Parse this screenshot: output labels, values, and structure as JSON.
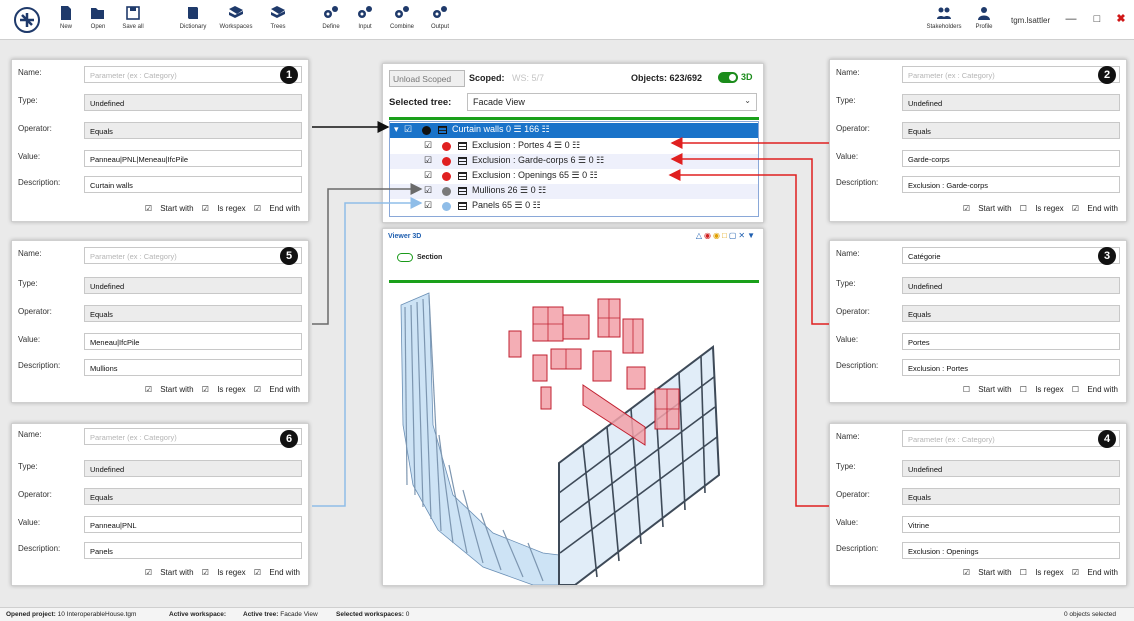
{
  "toolbar": {
    "buttons": [
      {
        "label": "New",
        "icon": "file-icon"
      },
      {
        "label": "Open",
        "icon": "folder-open-icon"
      },
      {
        "label": "Save all",
        "icon": "save-icon"
      },
      {
        "label": "Dictionary",
        "icon": "book-icon"
      },
      {
        "label": "Workspaces",
        "icon": "tag-icon"
      },
      {
        "label": "Trees",
        "icon": "tag-icon"
      },
      {
        "label": "Define",
        "icon": "gears-icon"
      },
      {
        "label": "Input",
        "icon": "gears-icon"
      },
      {
        "label": "Combine",
        "icon": "gears-icon"
      },
      {
        "label": "Output",
        "icon": "gears-icon"
      }
    ],
    "right_buttons": [
      {
        "label": "Stakeholders",
        "icon": "users-icon"
      },
      {
        "label": "Profile",
        "icon": "user-icon"
      }
    ],
    "user": "tgm.lsattler"
  },
  "labels": {
    "name": "Name:",
    "type": "Type:",
    "operator": "Operator:",
    "value": "Value:",
    "description": "Description:",
    "start_with": "Start with",
    "is_regex": "Is regex",
    "end_with": "End with",
    "placeholder": "Parameter (ex : Category)"
  },
  "cards": [
    {
      "num": "1",
      "name": "",
      "type": "Undefined",
      "operator": "Equals",
      "value": "Panneau|PNL|Meneau|IfcPile",
      "description": "Curtain walls",
      "start_with": true,
      "is_regex": true,
      "end_with": true
    },
    {
      "num": "2",
      "name": "",
      "type": "Undefined",
      "operator": "Equals",
      "value": "Garde-corps",
      "description": "Exclusion : Garde-corps",
      "start_with": true,
      "is_regex": false,
      "end_with": true
    },
    {
      "num": "5",
      "name": "",
      "type": "Undefined",
      "operator": "Equals",
      "value": "Meneau|IfcPile",
      "description": "Mullions",
      "start_with": true,
      "is_regex": true,
      "end_with": true
    },
    {
      "num": "3",
      "name": "Catégorie",
      "type": "Undefined",
      "operator": "Equals",
      "value": "Portes",
      "description": "Exclusion : Portes",
      "start_with": false,
      "is_regex": false,
      "end_with": false
    },
    {
      "num": "6",
      "name": "",
      "type": "Undefined",
      "operator": "Equals",
      "value": "Panneau|PNL",
      "description": "Panels",
      "start_with": true,
      "is_regex": true,
      "end_with": true
    },
    {
      "num": "4",
      "name": "",
      "type": "Undefined",
      "operator": "Equals",
      "value": "Vitrine",
      "description": "Exclusion : Openings",
      "start_with": true,
      "is_regex": false,
      "end_with": true
    }
  ],
  "tree_panel": {
    "unload_label": "Unload Scoped",
    "scoped_label": "Scoped:",
    "ws_label": "WS: 5/7",
    "objects_label": "Objects: 623/692",
    "toggle_3d_label": "3D",
    "selected_tree_label": "Selected tree:",
    "selected_tree_value": "Facade View",
    "nodes": [
      {
        "label": "Curtain walls   0 ☰ 166 ☷",
        "color": "#111111",
        "checkbox": "☑"
      },
      {
        "label": "Exclusion : Portes   4 ☰ 0 ☷",
        "color": "#e02020",
        "checkbox": "☑"
      },
      {
        "label": "Exclusion : Garde-corps   6 ☰ 0 ☷",
        "color": "#e02020",
        "checkbox": "☑"
      },
      {
        "label": "Exclusion : Openings   65 ☰ 0 ☷",
        "color": "#e02020",
        "checkbox": "☑"
      },
      {
        "label": "Mullions   26 ☰ 0 ☷",
        "color": "#7a7a7a",
        "checkbox": "☑"
      },
      {
        "label": "Panels   65 ☰ 0 ☷",
        "color": "#8fbde8",
        "checkbox": "☑"
      }
    ]
  },
  "viewer": {
    "title": "Viewer 3D",
    "section_label": "Section"
  },
  "status": {
    "opened_project_label": "Opened project:",
    "opened_project_value": "10 InteroperableHouse.tgm",
    "active_workspace_label": "Active workspace:",
    "active_workspace_value": "",
    "active_tree_label": "Active tree:",
    "active_tree_value": "Facade View",
    "selected_ws_label": "Selected workspaces:",
    "selected_ws_value": "0",
    "objects_selected": "0 objects selected"
  },
  "colors": {
    "accent_blue": "#1a73c9",
    "green": "#1aa01a",
    "exclusion_red": "#e02020",
    "mullion_gray": "#7a7a7a",
    "panel_blue": "#8fbde8"
  }
}
